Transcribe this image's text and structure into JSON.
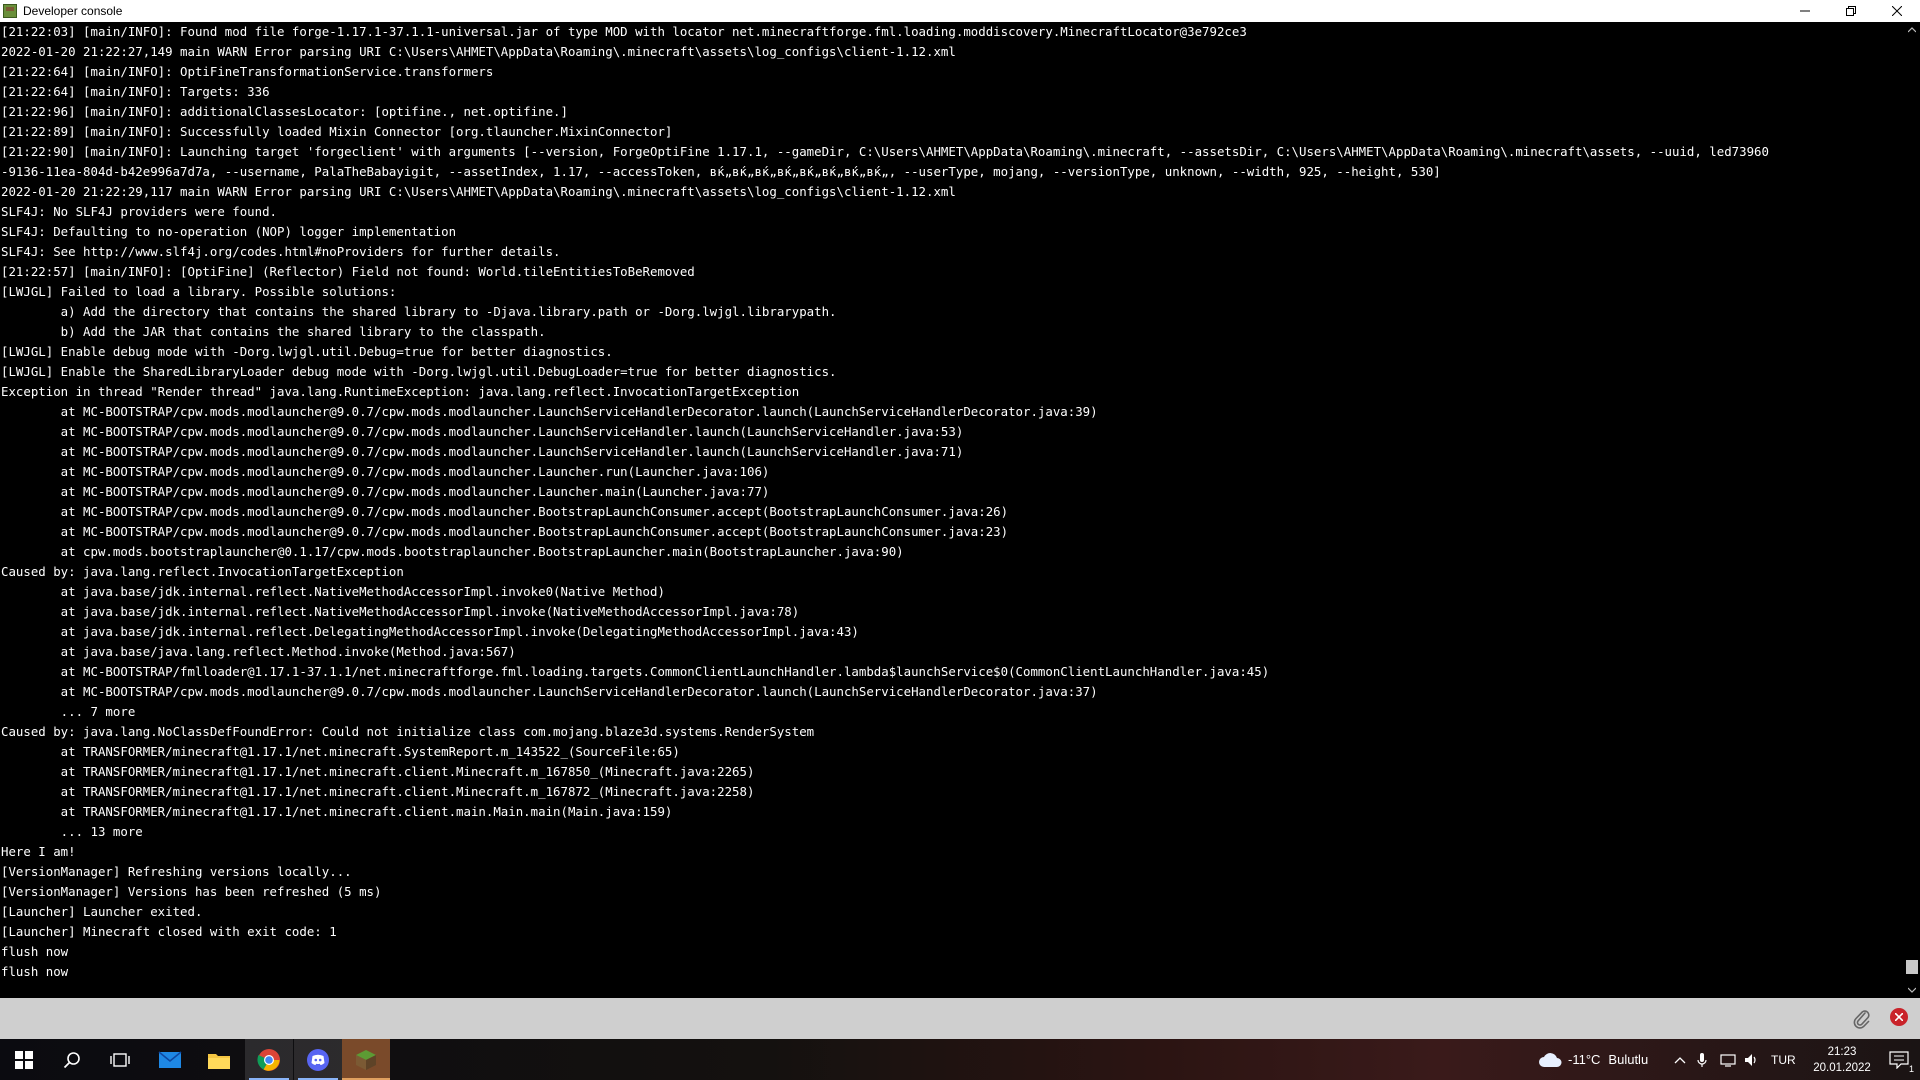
{
  "window": {
    "title": "Developer console"
  },
  "console": {
    "lines": [
      "[21:22:03] [main/INFO]: Found mod file forge-1.17.1-37.1.1-universal.jar of type MOD with locator net.minecraftforge.fml.loading.moddiscovery.MinecraftLocator@3e792ce3",
      "2022-01-20 21:22:27,149 main WARN Error parsing URI C:\\Users\\AHMET\\AppData\\Roaming\\.minecraft\\assets\\log_configs\\client-1.12.xml",
      "[21:22:64] [main/INFO]: OptiFineTransformationService.transformers",
      "[21:22:64] [main/INFO]: Targets: 336",
      "[21:22:96] [main/INFO]: additionalClassesLocator: [optifine., net.optifine.]",
      "[21:22:89] [main/INFO]: Successfully loaded Mixin Connector [org.tlauncher.MixinConnector]",
      "[21:22:90] [main/INFO]: Launching target 'forgeclient' with arguments [--version, ForgeOptiFine 1.17.1, --gameDir, C:\\Users\\AHMET\\AppData\\Roaming\\.minecraft, --assetsDir, C:\\Users\\AHMET\\AppData\\Roaming\\.minecraft\\assets, --uuid, led73960",
      "-9136-11ea-804d-b42e996a7d7a, --username, PalaTheBabayigit, --assetIndex, 1.17, --accessToken, вќ„вќ„вќ„вќ„вќ„вќ„вќ„вќ„, --userType, mojang, --versionType, unknown, --width, 925, --height, 530]",
      "2022-01-20 21:22:29,117 main WARN Error parsing URI C:\\Users\\AHMET\\AppData\\Roaming\\.minecraft\\assets\\log_configs\\client-1.12.xml",
      "SLF4J: No SLF4J providers were found.",
      "SLF4J: Defaulting to no-operation (NOP) logger implementation",
      "SLF4J: See http://www.slf4j.org/codes.html#noProviders for further details.",
      "[21:22:57] [main/INFO]: [OptiFine] (Reflector) Field not found: World.tileEntitiesToBeRemoved",
      "[LWJGL] Failed to load a library. Possible solutions:",
      "        a) Add the directory that contains the shared library to -Djava.library.path or -Dorg.lwjgl.librarypath.",
      "        b) Add the JAR that contains the shared library to the classpath.",
      "[LWJGL] Enable debug mode with -Dorg.lwjgl.util.Debug=true for better diagnostics.",
      "[LWJGL] Enable the SharedLibraryLoader debug mode with -Dorg.lwjgl.util.DebugLoader=true for better diagnostics.",
      "Exception in thread \"Render thread\" java.lang.RuntimeException: java.lang.reflect.InvocationTargetException",
      "        at MC-BOOTSTRAP/cpw.mods.modlauncher@9.0.7/cpw.mods.modlauncher.LaunchServiceHandlerDecorator.launch(LaunchServiceHandlerDecorator.java:39)",
      "        at MC-BOOTSTRAP/cpw.mods.modlauncher@9.0.7/cpw.mods.modlauncher.LaunchServiceHandler.launch(LaunchServiceHandler.java:53)",
      "        at MC-BOOTSTRAP/cpw.mods.modlauncher@9.0.7/cpw.mods.modlauncher.LaunchServiceHandler.launch(LaunchServiceHandler.java:71)",
      "        at MC-BOOTSTRAP/cpw.mods.modlauncher@9.0.7/cpw.mods.modlauncher.Launcher.run(Launcher.java:106)",
      "        at MC-BOOTSTRAP/cpw.mods.modlauncher@9.0.7/cpw.mods.modlauncher.Launcher.main(Launcher.java:77)",
      "        at MC-BOOTSTRAP/cpw.mods.modlauncher@9.0.7/cpw.mods.modlauncher.BootstrapLaunchConsumer.accept(BootstrapLaunchConsumer.java:26)",
      "        at MC-BOOTSTRAP/cpw.mods.modlauncher@9.0.7/cpw.mods.modlauncher.BootstrapLaunchConsumer.accept(BootstrapLaunchConsumer.java:23)",
      "        at cpw.mods.bootstraplauncher@0.1.17/cpw.mods.bootstraplauncher.BootstrapLauncher.main(BootstrapLauncher.java:90)",
      "Caused by: java.lang.reflect.InvocationTargetException",
      "        at java.base/jdk.internal.reflect.NativeMethodAccessorImpl.invoke0(Native Method)",
      "        at java.base/jdk.internal.reflect.NativeMethodAccessorImpl.invoke(NativeMethodAccessorImpl.java:78)",
      "        at java.base/jdk.internal.reflect.DelegatingMethodAccessorImpl.invoke(DelegatingMethodAccessorImpl.java:43)",
      "        at java.base/java.lang.reflect.Method.invoke(Method.java:567)",
      "        at MC-BOOTSTRAP/fmlloader@1.17.1-37.1.1/net.minecraftforge.fml.loading.targets.CommonClientLaunchHandler.lambda$launchService$0(CommonClientLaunchHandler.java:45)",
      "        at MC-BOOTSTRAP/cpw.mods.modlauncher@9.0.7/cpw.mods.modlauncher.LaunchServiceHandlerDecorator.launch(LaunchServiceHandlerDecorator.java:37)",
      "        ... 7 more",
      "Caused by: java.lang.NoClassDefFoundError: Could not initialize class com.mojang.blaze3d.systems.RenderSystem",
      "        at TRANSFORMER/minecraft@1.17.1/net.minecraft.SystemReport.m_143522_(SourceFile:65)",
      "        at TRANSFORMER/minecraft@1.17.1/net.minecraft.client.Minecraft.m_167850_(Minecraft.java:2265)",
      "        at TRANSFORMER/minecraft@1.17.1/net.minecraft.client.Minecraft.m_167872_(Minecraft.java:2258)",
      "        at TRANSFORMER/minecraft@1.17.1/net.minecraft.client.main.Main.main(Main.java:159)",
      "        ... 13 more",
      "Here I am!",
      "[VersionManager] Refreshing versions locally...",
      "[VersionManager] Versions has been refreshed (5 ms)",
      "[Launcher] Launcher exited.",
      "[Launcher] Minecraft closed with exit code: 1",
      "flush now",
      "flush now"
    ]
  },
  "input": {
    "value": "",
    "placeholder": ""
  },
  "taskbar": {
    "apps": [
      "start-icon",
      "search-icon",
      "task-view-icon",
      "mail-icon",
      "file-explorer-icon",
      "chrome-icon",
      "discord-icon",
      "minecraft-launcher-icon"
    ],
    "weather_temp": "-11°C",
    "weather_desc": "Bulutlu",
    "language": "TUR",
    "time": "21:23",
    "date": "20.01.2022",
    "notification_count": "1"
  },
  "colors": {
    "console_bg": "#000000",
    "console_text": "#ffffff",
    "input_bar_bg": "#cfcfcf",
    "close_button_red": "#c9232a"
  }
}
